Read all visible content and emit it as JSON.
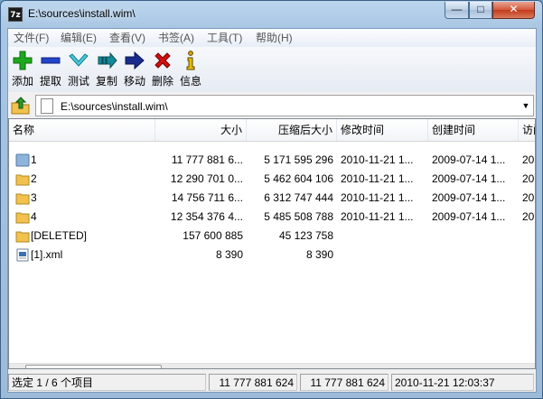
{
  "window": {
    "app_icon_text": "7z",
    "title": "E:\\sources\\install.wim\\",
    "minimize": "—",
    "maximize": "□",
    "close": "✕"
  },
  "menu": [
    {
      "label": "文件(F)"
    },
    {
      "label": "编辑(E)"
    },
    {
      "label": "查看(V)"
    },
    {
      "label": "书签(A)"
    },
    {
      "label": "工具(T)"
    },
    {
      "label": "帮助(H)"
    }
  ],
  "toolbar": [
    {
      "label": "添加",
      "icon": "add-icon",
      "color": "#1da81d"
    },
    {
      "label": "提取",
      "icon": "extract-icon",
      "color": "#2244cc"
    },
    {
      "label": "测试",
      "icon": "test-icon",
      "color": "#22a0b8"
    },
    {
      "label": "复制",
      "icon": "copy-icon",
      "color": "#138a9a"
    },
    {
      "label": "移动",
      "icon": "move-icon",
      "color": "#1a2c8c"
    },
    {
      "label": "删除",
      "icon": "delete-icon",
      "color": "#d01010"
    },
    {
      "label": "信息",
      "icon": "info-icon",
      "color": "#d8a800"
    }
  ],
  "address": {
    "path": "E:\\sources\\install.wim\\",
    "up_icon": "folder-up-icon"
  },
  "columns": [
    {
      "label": "名称"
    },
    {
      "label": "大小"
    },
    {
      "label": "压缩后大小"
    },
    {
      "label": "修改时间"
    },
    {
      "label": "创建时间"
    },
    {
      "label": "访问"
    }
  ],
  "rows": [
    {
      "name": "1",
      "icon": "folder-blue-icon",
      "size": "11 777 881 6...",
      "packed": "5 171 595 296",
      "modified": "2010-11-21 1...",
      "created": "2009-07-14 1...",
      "accessed": "20"
    },
    {
      "name": "2",
      "icon": "folder-icon",
      "size": "12 290 701 0...",
      "packed": "5 462 604 106",
      "modified": "2010-11-21 1...",
      "created": "2009-07-14 1...",
      "accessed": "20"
    },
    {
      "name": "3",
      "icon": "folder-icon",
      "size": "14 756 711 6...",
      "packed": "6 312 747 444",
      "modified": "2010-11-21 1...",
      "created": "2009-07-14 1...",
      "accessed": "20"
    },
    {
      "name": "4",
      "icon": "folder-icon",
      "size": "12 354 376 4...",
      "packed": "5 485 508 788",
      "modified": "2010-11-21 1...",
      "created": "2009-07-14 1...",
      "accessed": "20"
    },
    {
      "name": "[DELETED]",
      "icon": "folder-icon",
      "size": "157 600 885",
      "packed": "45 123 758",
      "modified": "",
      "created": "",
      "accessed": ""
    },
    {
      "name": "[1].xml",
      "icon": "xml-file-icon",
      "size": "8 390",
      "packed": "8 390",
      "modified": "",
      "created": "",
      "accessed": ""
    }
  ],
  "status": {
    "selection": "选定 1 / 6 个项目",
    "size": "11 777 881 624",
    "packed": "11 777 881 624",
    "modified": "2010-11-21 12:03:37"
  },
  "colors": {
    "title_gradient": "#a9c6e3",
    "close_button": "#c23a1c",
    "folder": "#f2c14e",
    "folder_blue": "#8fb4d9"
  }
}
